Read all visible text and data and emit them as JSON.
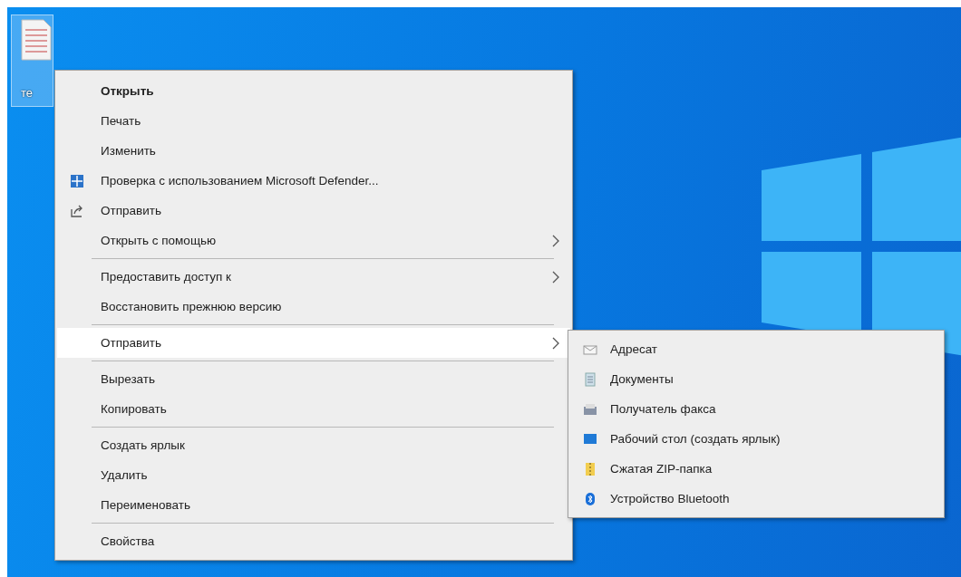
{
  "desktop": {
    "icon_label": "те"
  },
  "context_menu": {
    "groups": [
      [
        {
          "label": "Открыть",
          "kind": "plain",
          "bold": true,
          "has_submenu": false,
          "selected": false
        },
        {
          "label": "Печать",
          "kind": "plain",
          "bold": false,
          "has_submenu": false,
          "selected": false
        },
        {
          "label": "Изменить",
          "kind": "plain",
          "bold": false,
          "has_submenu": false,
          "selected": false
        },
        {
          "label": "Проверка с использованием Microsoft Defender...",
          "kind": "defender",
          "bold": false,
          "has_submenu": false,
          "selected": false
        },
        {
          "label": "Отправить",
          "kind": "share",
          "bold": false,
          "has_submenu": false,
          "selected": false
        },
        {
          "label": "Открыть с помощью",
          "kind": "plain",
          "bold": false,
          "has_submenu": true,
          "selected": false
        }
      ],
      [
        {
          "label": "Предоставить доступ к",
          "kind": "plain",
          "bold": false,
          "has_submenu": true,
          "selected": false
        },
        {
          "label": "Восстановить прежнюю версию",
          "kind": "plain",
          "bold": false,
          "has_submenu": false,
          "selected": false
        }
      ],
      [
        {
          "label": "Отправить",
          "kind": "plain",
          "bold": false,
          "has_submenu": true,
          "selected": true
        }
      ],
      [
        {
          "label": "Вырезать",
          "kind": "plain",
          "bold": false,
          "has_submenu": false,
          "selected": false
        },
        {
          "label": "Копировать",
          "kind": "plain",
          "bold": false,
          "has_submenu": false,
          "selected": false
        }
      ],
      [
        {
          "label": "Создать ярлык",
          "kind": "plain",
          "bold": false,
          "has_submenu": false,
          "selected": false
        },
        {
          "label": "Удалить",
          "kind": "plain",
          "bold": false,
          "has_submenu": false,
          "selected": false
        },
        {
          "label": "Переименовать",
          "kind": "plain",
          "bold": false,
          "has_submenu": false,
          "selected": false
        }
      ],
      [
        {
          "label": "Свойства",
          "kind": "plain",
          "bold": false,
          "has_submenu": false,
          "selected": false
        }
      ]
    ]
  },
  "submenu": {
    "items": [
      {
        "label": "Адресат",
        "kind": "mail"
      },
      {
        "label": "Документы",
        "kind": "documents"
      },
      {
        "label": "Получатель факса",
        "kind": "fax"
      },
      {
        "label": "Рабочий стол (создать ярлык)",
        "kind": "desktop"
      },
      {
        "label": "Сжатая ZIP-папка",
        "kind": "zip"
      },
      {
        "label": "Устройство Bluetooth",
        "kind": "bluetooth"
      }
    ]
  }
}
